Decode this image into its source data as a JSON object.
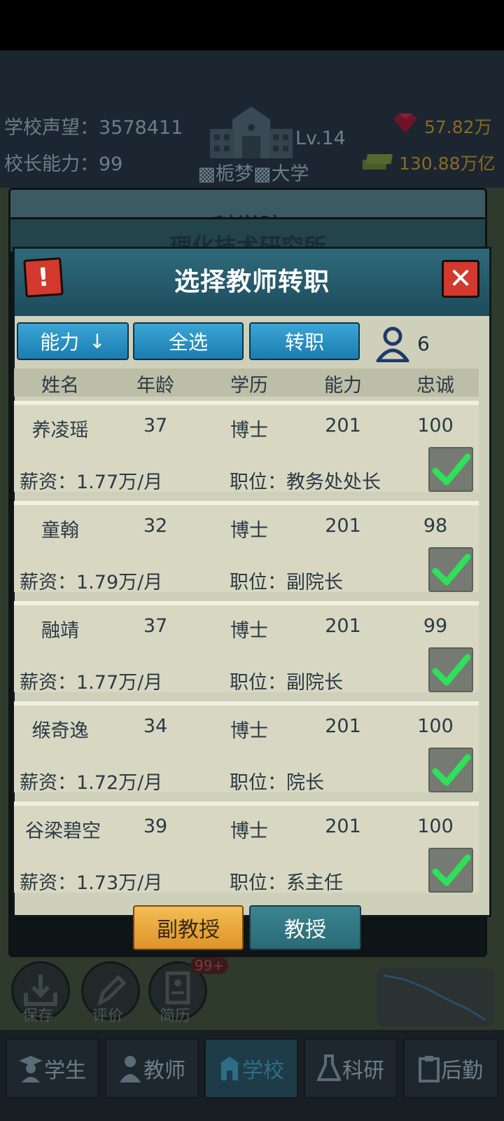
{
  "top": {
    "reputation": "学校声望：3578411",
    "principal_ability": "校长能力：99",
    "level": "Lv.14",
    "school_name": "▩栀梦▩大学",
    "gems": "57.82万",
    "money": "130.88万亿"
  },
  "background": {
    "stack_title_1": "科学院",
    "stack_title_2": "理化技术研究所"
  },
  "dialog": {
    "title": "选择教师转职",
    "sort_label": "能力",
    "sort_arrow": "↓",
    "select_all_label": "全选",
    "transfer_label": "转职",
    "people_count": "6",
    "columns": [
      "姓名",
      "年龄",
      "学历",
      "能力",
      "忠诚"
    ],
    "rows": [
      {
        "name": "养凌瑶",
        "age": "37",
        "edu": "博士",
        "ability": "201",
        "loyalty": "100",
        "salary": "薪资：1.77万/月",
        "position": "职位：教务处处长",
        "checked": true
      },
      {
        "name": "童翰",
        "age": "32",
        "edu": "博士",
        "ability": "201",
        "loyalty": "98",
        "salary": "薪资：1.79万/月",
        "position": "职位：副院长",
        "checked": true
      },
      {
        "name": "融靖",
        "age": "37",
        "edu": "博士",
        "ability": "201",
        "loyalty": "99",
        "salary": "薪资：1.77万/月",
        "position": "职位：副院长",
        "checked": true
      },
      {
        "name": "缑奇逸",
        "age": "34",
        "edu": "博士",
        "ability": "201",
        "loyalty": "100",
        "salary": "薪资：1.72万/月",
        "position": "职位：院长",
        "checked": true
      },
      {
        "name": "谷梁碧空",
        "age": "39",
        "edu": "博士",
        "ability": "201",
        "loyalty": "100",
        "salary": "薪资：1.73万/月",
        "position": "职位：系主任",
        "checked": true
      }
    ],
    "tab_associate": "副教授",
    "tab_professor": "教授"
  },
  "scene_buttons": {
    "save": "保存",
    "review": "评价",
    "resume": "简历",
    "resume_badge": "99+"
  },
  "nav": {
    "students": "学生",
    "teachers": "教师",
    "school": "学校",
    "research": "科研",
    "logistics": "后勤"
  },
  "colors": {
    "header_teal": "#245868",
    "button_blue": "#1b7cb0",
    "close_red": "#d3392c",
    "check_green": "#2ee05a",
    "tab_orange": "#dd9429"
  }
}
